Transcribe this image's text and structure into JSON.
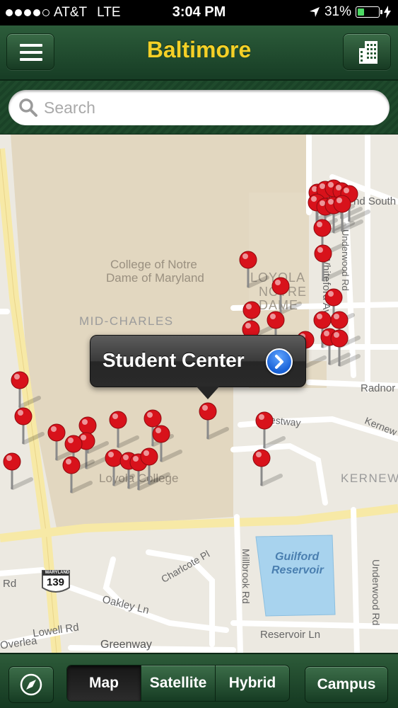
{
  "status_bar": {
    "carrier": "AT&T",
    "network": "LTE",
    "time": "3:04 PM",
    "battery": "31%",
    "battery_level": 0.31
  },
  "nav": {
    "title": "Baltimore",
    "left_icon": "menu-icon",
    "right_icon": "building-icon"
  },
  "search": {
    "placeholder": "Search",
    "value": ""
  },
  "map": {
    "area_labels": [
      "College of Notre",
      "Dame of Maryland",
      "MID-CHARLES",
      "LOYOLA",
      "NOTRE",
      "DAME",
      "KERNEW",
      "Loyola College"
    ],
    "street_labels": [
      "nd South",
      "Whiteford Ave",
      "Underwood Rd",
      "Radnor",
      "estway",
      "Kernew",
      "Millbrook Rd",
      "Charlcote Pl",
      "Oakley Ln",
      "Greenway",
      "Reservoir Ln",
      "Underwood Rd",
      "Rd",
      "Lowell Rd",
      "Overlea"
    ],
    "water_label_1": "Guilford",
    "water_label_2": "Reservoir",
    "shield_state": "MARYLAND",
    "shield_number": "139",
    "callout": {
      "title": "Student Center",
      "action_icon": "chevron-right-icon"
    },
    "pin_color": "#d8121b"
  },
  "toolbar": {
    "locate_icon": "compass-icon",
    "segments": [
      "Map",
      "Satellite",
      "Hybrid"
    ],
    "selected_segment": "Map",
    "campus_label": "Campus"
  },
  "colors": {
    "nav_green": "#1f4a2c",
    "title_yellow": "#f4d027",
    "map_background": "#ece9e1",
    "campus_area": "#e2d7c0",
    "water": "#a8d3ee"
  }
}
